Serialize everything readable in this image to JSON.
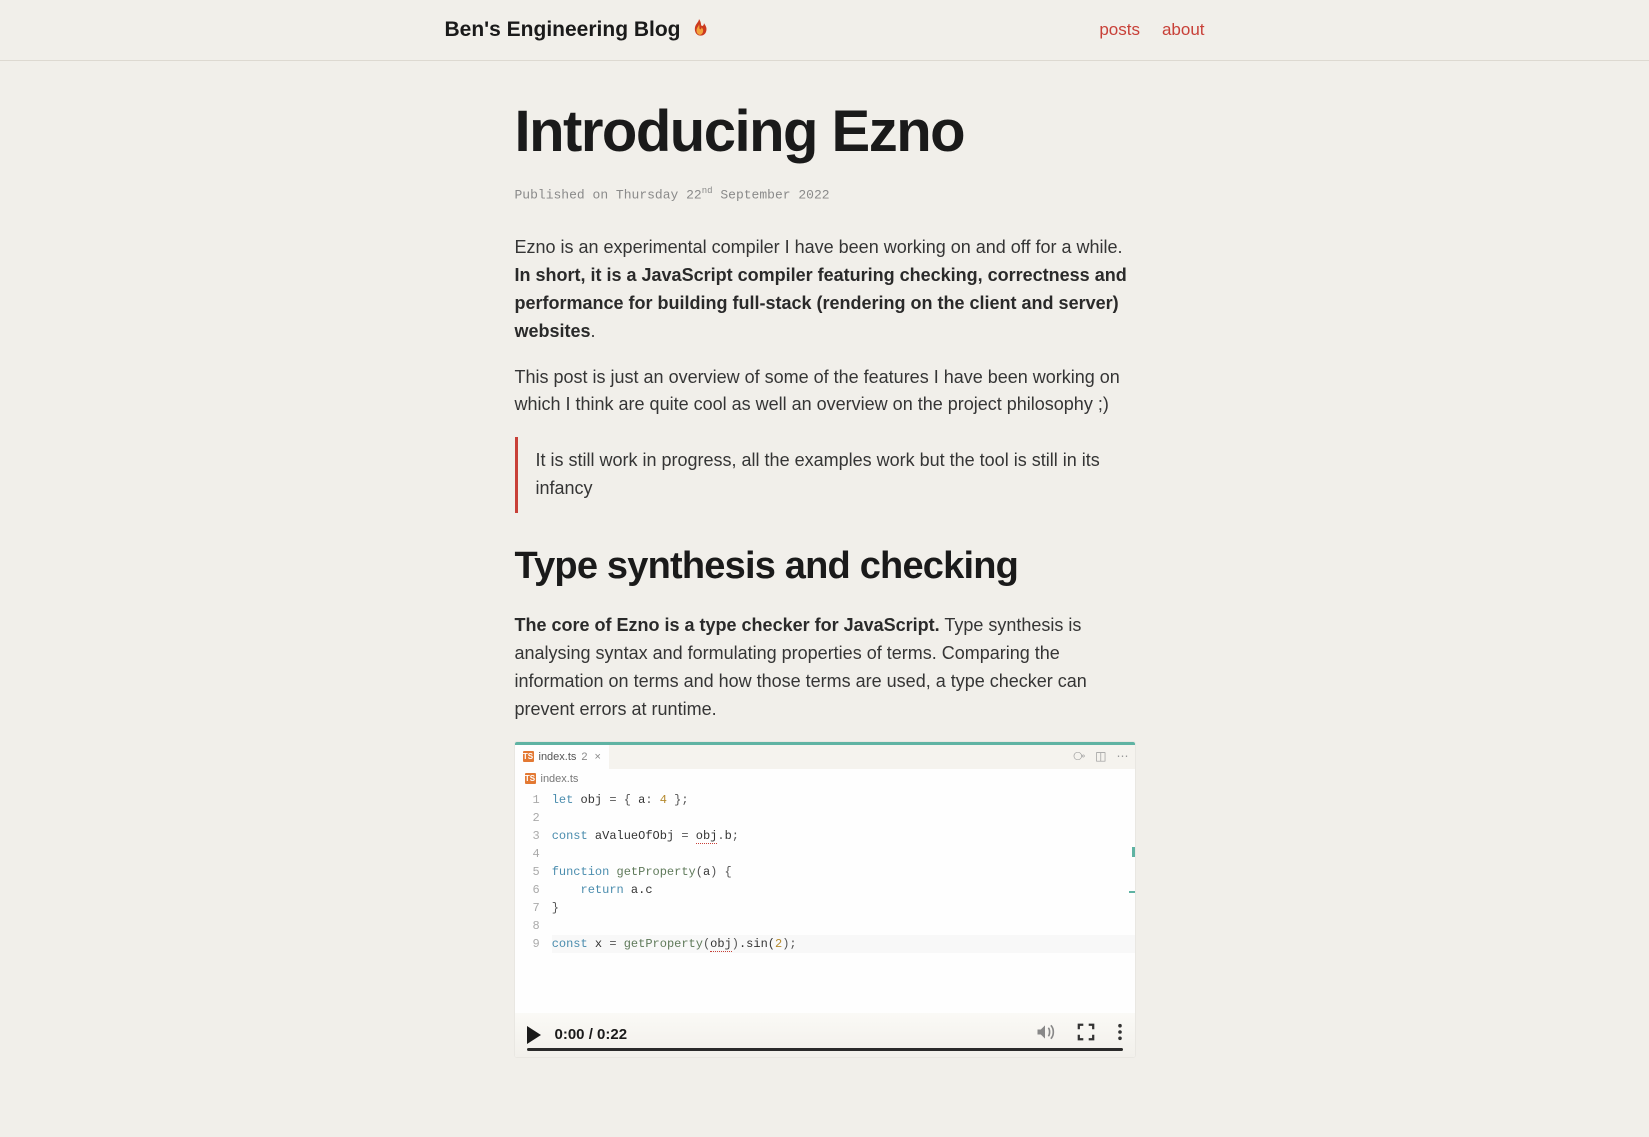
{
  "header": {
    "site_title": "Ben's Engineering Blog",
    "nav": {
      "posts": "posts",
      "about": "about"
    }
  },
  "post": {
    "title": "Introducing Ezno",
    "meta_prefix": "Published on Thursday 22",
    "meta_ord": "nd",
    "meta_suffix": " September 2022",
    "p1_a": "Ezno is an experimental compiler I have been working on and off for a while. ",
    "p1_b": "In short, it is a JavaScript compiler featuring checking, correctness and performance for building full-stack (rendering on the client and server) websites",
    "p1_c": ".",
    "p2": "This post is just an overview of some of the features I have been working on which I think are quite cool as well an overview on the project philosophy ;)",
    "quote": "It is still work in progress, all the examples work but the tool is still in its infancy",
    "h2": "Type synthesis and checking",
    "p3_a": "The core of Ezno is a type checker for JavaScript.",
    "p3_b": " Type synthesis is analysing syntax and formulating properties of terms. Comparing the information on terms and how those terms are used, a type checker can prevent errors at runtime."
  },
  "editor": {
    "tab_filename": "index.ts",
    "tab_count": "2",
    "breadcrumb": "index.ts",
    "line_numbers": [
      "1",
      "2",
      "3",
      "4",
      "5",
      "6",
      "7",
      "8",
      "9"
    ],
    "code": {
      "l1": {
        "let": "let",
        "obj": "obj",
        "eq": " = ",
        "lb": "{ ",
        "key": "a",
        "colon": ": ",
        "val": "4",
        "rb": " };"
      },
      "l3": {
        "const": "const",
        "name": "aValueOfObj",
        "eq": " = ",
        "obj": "obj",
        "dot": ".",
        "prop": "b",
        "semi": ";"
      },
      "l5": {
        "fn": "function",
        "name": "getProperty",
        "lp": "(",
        "arg": "a",
        "rp": ")",
        "lb": " {"
      },
      "l6": {
        "ret": "return",
        "expr": " a.c"
      },
      "l7": {
        "rb": "}"
      },
      "l9": {
        "const": "const",
        "name": "x",
        "eq": " = ",
        "call": "getProperty",
        "lp": "(",
        "arg": "obj",
        "rp": ")",
        "chain": ".sin(",
        "two": "2",
        "tail": ");"
      }
    }
  },
  "player": {
    "current": "0:00",
    "sep": " / ",
    "total": "0:22"
  }
}
